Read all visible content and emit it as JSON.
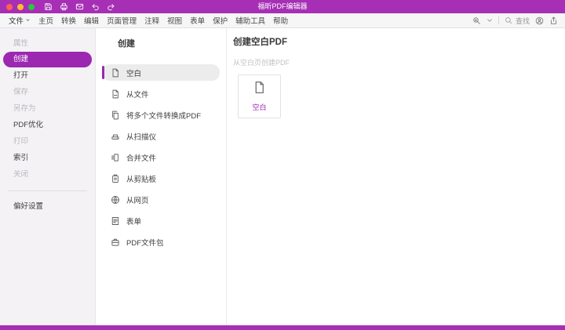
{
  "window": {
    "title": "福昕PDF编辑器"
  },
  "colors": {
    "accent": "#9c27b0",
    "titlebar": "#a62fb5",
    "traffic_red": "#ff5f57",
    "traffic_yellow": "#febc2e",
    "traffic_green": "#28c840",
    "selected_row_bg": "#ececec"
  },
  "titlebar": {
    "icons": [
      "save-icon",
      "print-icon",
      "mail-icon",
      "undo-icon",
      "redo-icon"
    ]
  },
  "menubar": {
    "items": [
      "文件",
      "主页",
      "转换",
      "编辑",
      "页面管理",
      "注释",
      "视图",
      "表单",
      "保护",
      "辅助工具",
      "帮助"
    ],
    "search_label": "查找",
    "right_icons": [
      "search-text-icon",
      "chevron-down-icon",
      "search-icon",
      "account-icon",
      "share-icon"
    ]
  },
  "sidebar": {
    "items": [
      {
        "label": "属性",
        "state": "disabled"
      },
      {
        "label": "创建",
        "state": "selected"
      },
      {
        "label": "打开",
        "state": "normal"
      },
      {
        "label": "保存",
        "state": "disabled"
      },
      {
        "label": "另存为",
        "state": "disabled"
      },
      {
        "label": "PDF优化",
        "state": "normal"
      },
      {
        "label": "打印",
        "state": "disabled"
      },
      {
        "label": "索引",
        "state": "normal"
      },
      {
        "label": "关闭",
        "state": "disabled"
      }
    ],
    "footer_label": "偏好设置"
  },
  "create_panel": {
    "title": "创建",
    "items": [
      {
        "label": "空白",
        "icon": "blank-file-icon",
        "selected": true
      },
      {
        "label": "从文件",
        "icon": "from-file-icon",
        "selected": false
      },
      {
        "label": "将多个文件转换成PDF",
        "icon": "multiple-files-icon",
        "selected": false
      },
      {
        "label": "从扫描仪",
        "icon": "scanner-icon",
        "selected": false
      },
      {
        "label": "合并文件",
        "icon": "combine-files-icon",
        "selected": false
      },
      {
        "label": "从剪贴板",
        "icon": "clipboard-icon",
        "selected": false
      },
      {
        "label": "从网页",
        "icon": "web-page-icon",
        "selected": false
      },
      {
        "label": "表单",
        "icon": "form-icon",
        "selected": false
      },
      {
        "label": "PDF文件包",
        "icon": "pdf-portfolio-icon",
        "selected": false
      }
    ]
  },
  "detail_panel": {
    "title": "创建空白PDF",
    "subtitle": "从空白页创建PDF",
    "card_label": "空白"
  }
}
